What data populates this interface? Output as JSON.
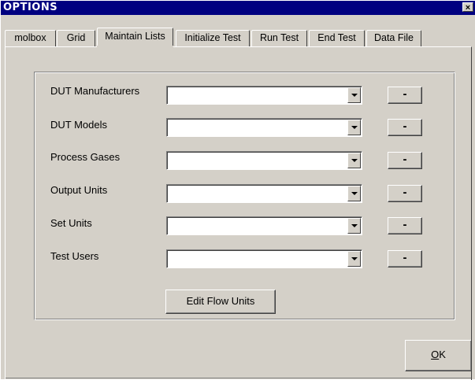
{
  "window": {
    "title": "OPTIONS",
    "close_glyph": "×"
  },
  "tabs": [
    {
      "label": "molbox"
    },
    {
      "label": "Grid"
    },
    {
      "label": "Maintain Lists",
      "active": true
    },
    {
      "label": "Initialize Test"
    },
    {
      "label": "Run Test"
    },
    {
      "label": "End Test"
    },
    {
      "label": "Data File"
    }
  ],
  "lists": [
    {
      "label": "DUT Manufacturers",
      "value": "",
      "remove_label": "-"
    },
    {
      "label": "DUT Models",
      "value": "",
      "remove_label": "-"
    },
    {
      "label": "Process Gases",
      "value": "",
      "remove_label": "-"
    },
    {
      "label": "Output Units",
      "value": "",
      "remove_label": "-"
    },
    {
      "label": "Set Units",
      "value": "",
      "remove_label": "-"
    },
    {
      "label": "Test Users",
      "value": "",
      "remove_label": "-"
    }
  ],
  "edit_flow_units_label": "Edit Flow Units",
  "ok_label": {
    "accel": "O",
    "rest": "K"
  }
}
